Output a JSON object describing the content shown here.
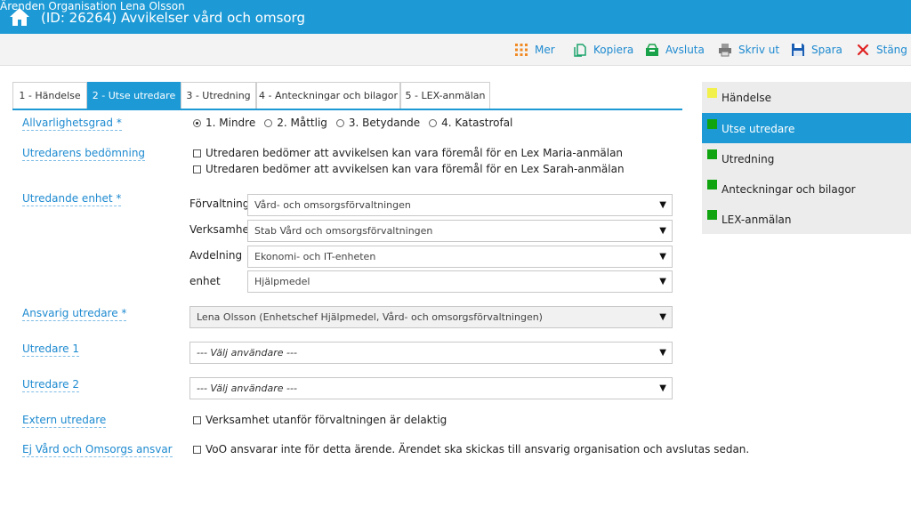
{
  "header": {
    "title": "(ID: 26264) Avvikelser vård och omsorg",
    "nav": [
      "Ärenden",
      "Organisation",
      "Lena Olsson"
    ]
  },
  "toolbar": {
    "more": "Mer",
    "copy": "Kopiera",
    "finish": "Avsluta",
    "print": "Skriv ut",
    "save": "Spara",
    "close": "Stäng"
  },
  "tabs": [
    "1 - Händelse",
    "2 - Utse utredare",
    "3 - Utredning",
    "4 - Anteckningar och bilagor",
    "5 - LEX-anmälan"
  ],
  "form": {
    "severity": {
      "label": "Allvarlighetsgrad *",
      "options": [
        "1. Mindre",
        "2. Måttlig",
        "3. Betydande",
        "4. Katastrofal"
      ],
      "selected": "1. Mindre"
    },
    "assessment": {
      "label": "Utredarens bedömning",
      "options": [
        "Utredaren bedömer att avvikelsen kan vara föremål för en Lex Maria-anmälan",
        "Utredaren bedömer att avvikelsen kan vara föremål för en Lex Sarah-anmälan"
      ]
    },
    "unit": {
      "label": "Utredande enhet *",
      "forvaltning_label": "Förvaltning",
      "forvaltning_value": "Vård- och omsorgsförvaltningen",
      "verksamhet_label": "Verksamhet",
      "verksamhet_value": "Stab Vård och omsorgsförvaltningen",
      "avdelning_label": "Avdelning",
      "avdelning_value": "Ekonomi- och IT-enheten",
      "enhet_label": "enhet",
      "enhet_value": "Hjälpmedel"
    },
    "responsible": {
      "label": "Ansvarig utredare *",
      "value": "Lena Olsson (Enhetschef Hjälpmedel, Vård- och omsorgsförvaltningen)"
    },
    "investigator1": {
      "label": "Utredare 1",
      "placeholder": "--- Välj användare ---"
    },
    "investigator2": {
      "label": "Utredare 2",
      "placeholder": "--- Välj användare ---"
    },
    "external": {
      "label": "Extern utredare",
      "option": "Verksamhet utanför förvaltningen är delaktig"
    },
    "not_voo": {
      "label": "Ej Vård och Omsorgs ansvar",
      "option": "VoO ansvarar inte för detta ärende. Ärendet ska skickas till ansvarig organisation och avslutas sedan."
    }
  },
  "steps": [
    {
      "label": "Händelse",
      "status": "yellow"
    },
    {
      "label": "Utse utredare",
      "status": "green"
    },
    {
      "label": "Utredning",
      "status": "green"
    },
    {
      "label": "Anteckningar och bilagor",
      "status": "green"
    },
    {
      "label": "LEX-anmälan",
      "status": "green"
    }
  ],
  "colors": {
    "primary": "#1d9ad6",
    "yellow": "#f2f04a",
    "green": "#11a411",
    "link": "#1d8ad0"
  }
}
